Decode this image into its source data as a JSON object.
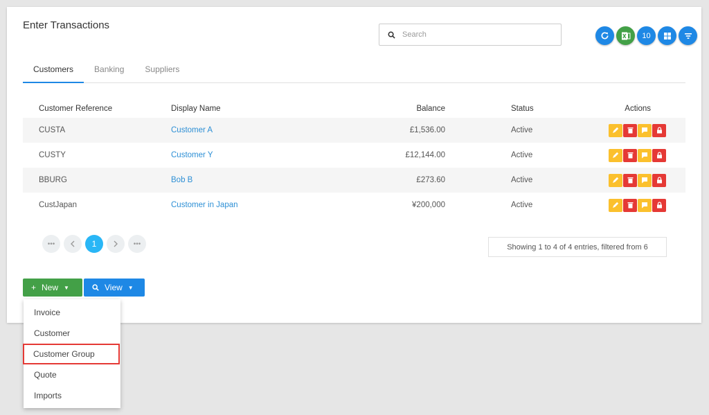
{
  "page": {
    "title": "Enter Transactions"
  },
  "search": {
    "placeholder": "Search"
  },
  "toolbar": {
    "page_size": "10"
  },
  "tabs": [
    {
      "label": "Customers",
      "active": true
    },
    {
      "label": "Banking"
    },
    {
      "label": "Suppliers"
    }
  ],
  "table": {
    "headers": [
      "Customer Reference",
      "Display Name",
      "Balance",
      "Status",
      "Actions"
    ],
    "rows": [
      {
        "ref": "CUSTA",
        "name": "Customer A",
        "balance": "£1,536.00",
        "status": "Active"
      },
      {
        "ref": "CUSTY",
        "name": "Customer Y",
        "balance": "£12,144.00",
        "status": "Active"
      },
      {
        "ref": "BBURG",
        "name": "Bob B",
        "balance": "£273.60",
        "status": "Active"
      },
      {
        "ref": "CustJapan",
        "name": "Customer in Japan",
        "balance": "¥200,000",
        "status": "Active"
      }
    ]
  },
  "pagination": {
    "current": "1",
    "info": "Showing 1 to 4 of 4 entries, filtered from 6"
  },
  "buttons": {
    "new_label": "New",
    "view_label": "View"
  },
  "menu": {
    "items": [
      "Invoice",
      "Customer",
      "Customer Group",
      "Quote",
      "Imports"
    ],
    "highlighted": "Customer Group"
  },
  "colors": {
    "accent": "#1e88e5",
    "new": "#43a047",
    "highlight": "#e53935",
    "link": "#2d8fd5"
  }
}
